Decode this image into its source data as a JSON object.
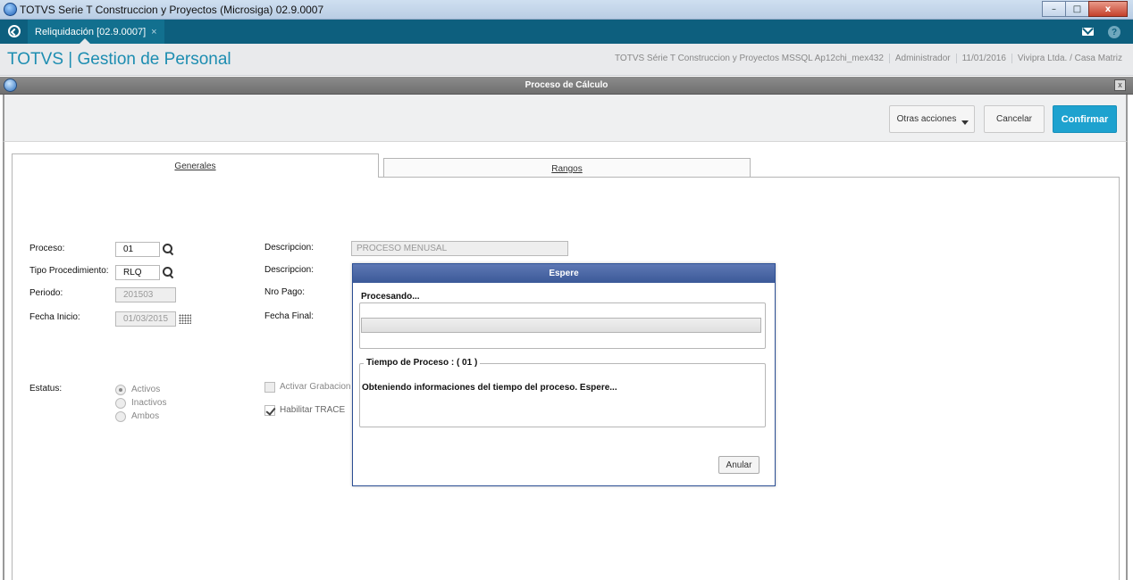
{
  "window": {
    "title": "TOTVS Serie T Construccion y Proyectos (Microsiga) 02.9.0007",
    "buttons": [
      "–",
      "□",
      "x"
    ]
  },
  "tabstrip": {
    "active_tab": "Reliquidación [02.9.0007]",
    "tab_close": "×",
    "help": "?"
  },
  "header": {
    "brand": "TOTVS | Gestion de Personal",
    "info": [
      "TOTVS Série T Construccion y Proyectos MSSQL Ap12chi_mex432",
      "Administrador",
      "11/01/2016",
      "Vivipra Ltda. / Casa Matriz"
    ]
  },
  "dialog": {
    "title": "Proceso de Cálculo",
    "close": "x",
    "actions": {
      "more": "Otras acciones",
      "cancel": "Cancelar",
      "confirm": "Confirmar"
    },
    "tabs": [
      "Generales",
      "Rangos"
    ]
  },
  "form": {
    "proceso_label": "Proceso:",
    "proceso_value": "01",
    "tipo_label": "Tipo Procedimiento:",
    "tipo_value": "RLQ",
    "periodo_label": "Periodo:",
    "periodo_value": "201503",
    "fecha_inicio_label": "Fecha Inicio:",
    "fecha_inicio_value": "01/03/2015",
    "desc1_label": "Descripcion:",
    "desc1_value": "PROCESO MENUSAL",
    "desc2_label": "Descripcion:",
    "nro_pago_label": "Nro Pago:",
    "fecha_final_label": "Fecha Final:",
    "estatus_label": "Estatus:",
    "estatus_options": [
      "Activos",
      "Inactivos",
      "Ambos"
    ],
    "estatus_selected": 0,
    "activar_grabacion": "Activar Grabacion",
    "habilitar_trace": "Habilitar TRACE"
  },
  "modal": {
    "title": "Espere",
    "processing_label": "Procesando...",
    "progress": 0,
    "time_legend": "Tiempo de Proceso : ( 01 )",
    "time_message": "Obteniendo informaciones del tiempo del proceso. Espere...",
    "cancel_button": "Anular"
  }
}
